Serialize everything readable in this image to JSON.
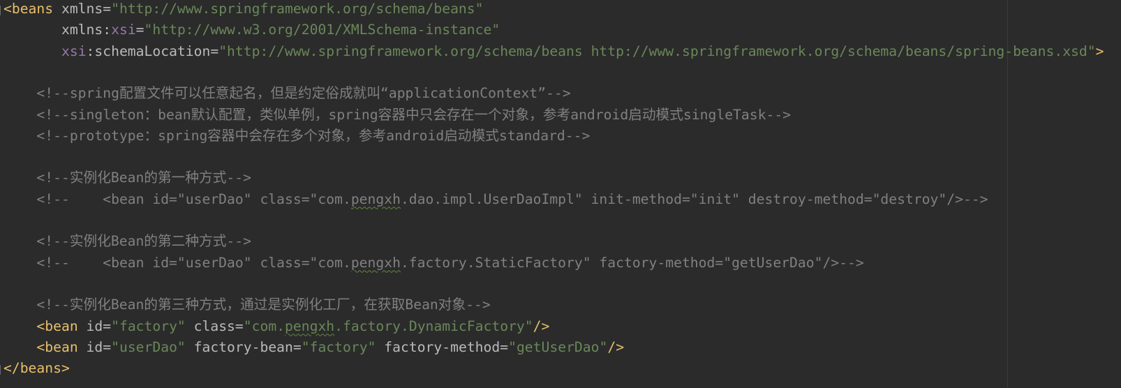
{
  "editor": {
    "lines": [
      [
        {
          "t": "<beans",
          "c": "tag"
        },
        {
          "t": " ",
          "c": "attr"
        },
        {
          "t": "xmlns",
          "c": "attr"
        },
        {
          "t": "=",
          "c": "attr"
        },
        {
          "t": "\"http://www.springframework.org/schema/beans\"",
          "c": "val"
        }
      ],
      [
        {
          "t": "       ",
          "c": "attr"
        },
        {
          "t": "xmlns",
          "c": "attr"
        },
        {
          "t": ":",
          "c": "attr"
        },
        {
          "t": "xsi",
          "c": "ns"
        },
        {
          "t": "=",
          "c": "attr"
        },
        {
          "t": "\"http://www.w3.org/2001/XMLSchema-instance\"",
          "c": "val"
        }
      ],
      [
        {
          "t": "       ",
          "c": "attr"
        },
        {
          "t": "xsi",
          "c": "ns"
        },
        {
          "t": ":schemaLocation",
          "c": "attr"
        },
        {
          "t": "=",
          "c": "attr"
        },
        {
          "t": "\"http://www.springframework.org/schema/beans http://www.springframework.org/schema/beans/spring-beans.xsd\"",
          "c": "val"
        },
        {
          "t": ">",
          "c": "tag"
        }
      ],
      [],
      [
        {
          "t": "    <!--spring配置文件可以任意起名，但是约定俗成就叫“applicationContext”-->",
          "c": "comment"
        }
      ],
      [
        {
          "t": "    <!--singleton：bean默认配置，类似单例，spring容器中只会存在一个对象，参考android启动模式singleTask-->",
          "c": "comment"
        }
      ],
      [
        {
          "t": "    <!--prototype：spring容器中会存在多个对象，参考android启动模式standard-->",
          "c": "comment"
        }
      ],
      [],
      [
        {
          "t": "    <!--实例化Bean的第一种方式-->",
          "c": "comment"
        }
      ],
      [
        {
          "t": "    <!--    <bean id=\"userDao\" class=\"com.",
          "c": "comment"
        },
        {
          "t": "pengxh",
          "c": "comment squiggle"
        },
        {
          "t": ".dao.impl.UserDaoImpl\" init-method=\"init\" destroy-method=\"destroy\"/>-->",
          "c": "comment"
        }
      ],
      [],
      [
        {
          "t": "    <!--实例化Bean的第二种方式-->",
          "c": "comment"
        }
      ],
      [
        {
          "t": "    <!--    <bean id=\"userDao\" class=\"com.",
          "c": "comment"
        },
        {
          "t": "pengxh",
          "c": "comment squiggle"
        },
        {
          "t": ".factory.StaticFactory\" factory-method=\"getUserDao\"/>-->",
          "c": "comment"
        }
      ],
      [],
      [
        {
          "t": "    <!--实例化Bean的第三种方式，通过是实例化工厂，在获取Bean对象-->",
          "c": "comment"
        }
      ],
      [
        {
          "t": "    ",
          "c": "attr"
        },
        {
          "t": "<bean",
          "c": "tag"
        },
        {
          "t": " id",
          "c": "attr"
        },
        {
          "t": "=",
          "c": "attr"
        },
        {
          "t": "\"factory\"",
          "c": "val"
        },
        {
          "t": " class",
          "c": "attr"
        },
        {
          "t": "=",
          "c": "attr"
        },
        {
          "t": "\"com.",
          "c": "val"
        },
        {
          "t": "pengxh",
          "c": "val squiggle"
        },
        {
          "t": ".factory.DynamicFactory\"",
          "c": "val"
        },
        {
          "t": "/>",
          "c": "tag"
        }
      ],
      [
        {
          "t": "    ",
          "c": "attr"
        },
        {
          "t": "<bean",
          "c": "tag"
        },
        {
          "t": " id",
          "c": "attr"
        },
        {
          "t": "=",
          "c": "attr"
        },
        {
          "t": "\"userDao\"",
          "c": "val"
        },
        {
          "t": " factory-bean",
          "c": "attr"
        },
        {
          "t": "=",
          "c": "attr"
        },
        {
          "t": "\"factory\"",
          "c": "val"
        },
        {
          "t": " factory-method",
          "c": "attr"
        },
        {
          "t": "=",
          "c": "attr"
        },
        {
          "t": "\"getUserDao\"",
          "c": "val"
        },
        {
          "t": "/>",
          "c": "tag"
        }
      ],
      [
        {
          "t": "</beans>",
          "c": "tag"
        }
      ]
    ]
  }
}
